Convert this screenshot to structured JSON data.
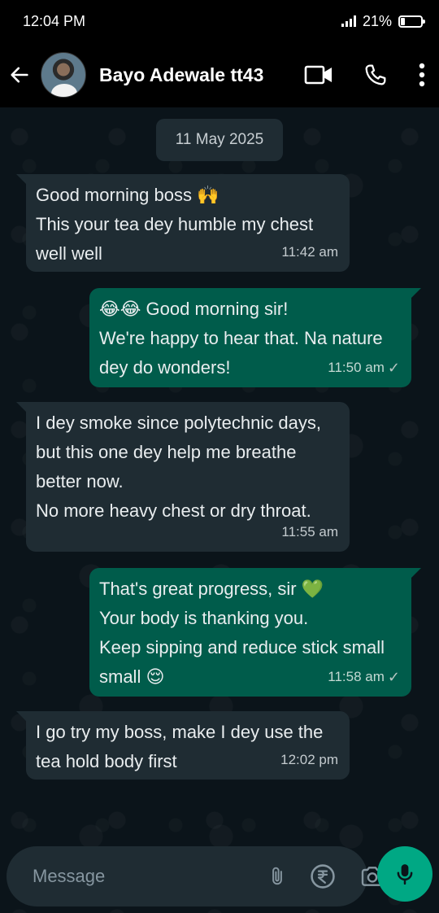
{
  "status_bar": {
    "time": "12:04 PM",
    "battery_percent": "21%",
    "battery_level": 0.21,
    "signal_icon": "signal-icon",
    "battery_icon": "battery-icon"
  },
  "header": {
    "contact_name": "Bayo Adewale tt43",
    "back_icon": "arrow-left-icon",
    "video_icon": "video-call-icon",
    "call_icon": "phone-icon",
    "menu_icon": "more-vertical-icon"
  },
  "chat": {
    "date": "11 May 2025",
    "messages": [
      {
        "direction": "incoming",
        "text": " Good morning boss 🙌\nThis your tea dey humble my chest well well",
        "time": "11:42 am"
      },
      {
        "direction": "outgoing",
        "text": " 😂😂 Good morning sir!\nWe're happy to hear that. Na nature dey do wonders!",
        "time": "11:50 am",
        "status": "✓"
      },
      {
        "direction": "incoming",
        "text": " I dey smoke since polytechnic days, but this one dey help me breathe better now.\nNo more heavy chest or dry throat.",
        "time": "11:55 am"
      },
      {
        "direction": "outgoing",
        "text": " That's great progress, sir 💚\nYour body is thanking you.\nKeep sipping and reduce stick small small 😌",
        "time": "11:58 am",
        "status": "✓"
      },
      {
        "direction": "incoming",
        "text": " I go try my boss, make I dey use the tea hold body first",
        "time": "12:02 pm"
      }
    ]
  },
  "composer": {
    "placeholder": "Message",
    "emoji_icon": "emoji-icon",
    "attach_icon": "paperclip-icon",
    "payment_icon": "rupee-icon",
    "camera_icon": "camera-icon",
    "mic_icon": "microphone-icon"
  },
  "colors": {
    "background": "#0b141a",
    "incoming_bubble": "#1f2c33",
    "outgoing_bubble": "#005c4b",
    "accent": "#00a884"
  }
}
